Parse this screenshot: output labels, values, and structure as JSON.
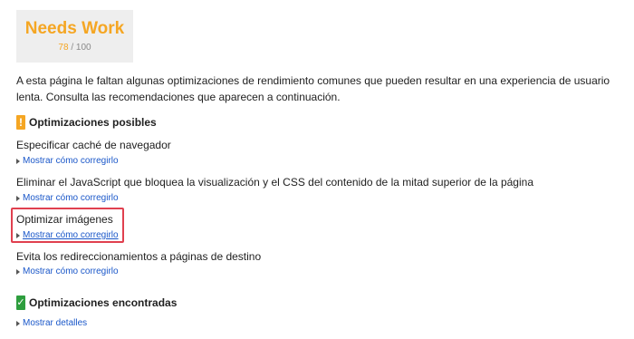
{
  "score": {
    "label": "Needs Work",
    "value": "78",
    "max": "/ 100"
  },
  "intro_text": "A esta página le faltan algunas optimizaciones de rendimiento comunes que pueden resultar en una experiencia de usuario lenta. Consulta las recomendaciones que aparecen a continuación.",
  "possible": {
    "icon": "!",
    "title": "Optimizaciones posibles",
    "rules": [
      {
        "title": "Especificar caché de navegador",
        "link": "Mostrar cómo corregirlo"
      },
      {
        "title": "Eliminar el JavaScript que bloquea la visualización y el CSS del contenido de la mitad superior de la página",
        "link": "Mostrar cómo corregirlo"
      },
      {
        "title": "Optimizar imágenes",
        "link": "Mostrar cómo corregirlo"
      },
      {
        "title": "Evita los redireccionamientos a páginas de destino",
        "link": "Mostrar cómo corregirlo"
      }
    ]
  },
  "found": {
    "icon": "✓",
    "title": "Optimizaciones encontradas",
    "link": "Mostrar detalles"
  },
  "colors": {
    "accent": "#f5a623",
    "success": "#2e9e3e",
    "link": "#1a57c9",
    "highlight": "#e0404f"
  }
}
